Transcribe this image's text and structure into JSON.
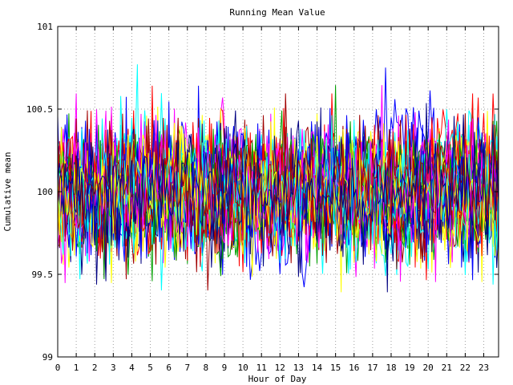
{
  "chart_data": {
    "type": "line",
    "title": "Running Mean Value",
    "xlabel": "Hour of Day",
    "ylabel": "Cumulative mean",
    "xlim": [
      0,
      23.8
    ],
    "ylim": [
      99,
      101
    ],
    "x_ticks": [
      "0",
      "1",
      "2",
      "3",
      "4",
      "5",
      "6",
      "7",
      "8",
      "9",
      "10",
      "11",
      "12",
      "13",
      "14",
      "15",
      "16",
      "17",
      "18",
      "19",
      "20",
      "21",
      "22",
      "23"
    ],
    "y_ticks": [
      "99",
      "99.5",
      "100",
      "100.5",
      "101"
    ],
    "grid": true,
    "legend": "none",
    "series_colors": [
      "#ff0000",
      "#00a000",
      "#0000ff",
      "#ff00ff",
      "#00ffff",
      "#ffff00",
      "#a00000",
      "#000080"
    ],
    "series_count": 40,
    "x_step": 0.1,
    "y_center": 100,
    "y_spread": 0.18,
    "series": [
      {
        "values": [
          100.05,
          99.82,
          100.21,
          99.95,
          100.12,
          99.88,
          100.31,
          99.74
        ]
      },
      {
        "values": [
          99.91,
          100.16,
          99.78,
          100.04,
          100.27,
          99.86,
          100.09,
          99.97
        ]
      },
      {
        "values": [
          100.18,
          99.93,
          100.02,
          99.71,
          100.14,
          100.36,
          99.89,
          100.06
        ]
      },
      {
        "values": [
          99.84,
          100.08,
          100.24,
          99.92,
          99.79,
          100.11,
          100.19,
          99.95
        ]
      },
      {
        "values": [
          100.01,
          100.22,
          99.87,
          100.15,
          99.96,
          99.73,
          100.28,
          100.03
        ]
      }
    ]
  }
}
